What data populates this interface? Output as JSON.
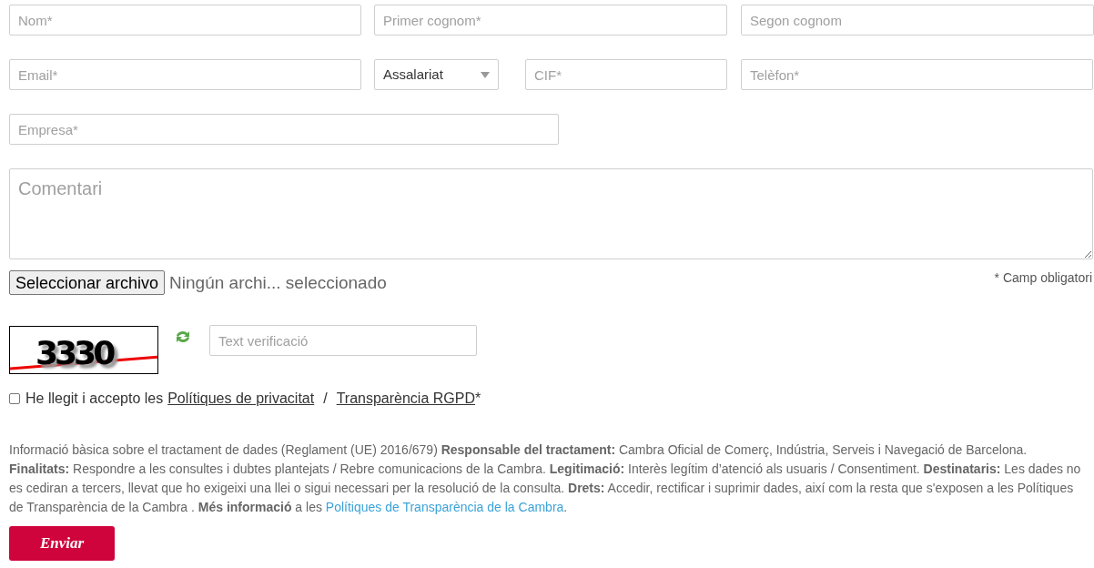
{
  "fields_row_1": [
    {
      "placeholder": "Nom*"
    },
    {
      "placeholder": "Primer cognom*"
    },
    {
      "placeholder": "Segon cognom"
    }
  ],
  "fields_row_2": [
    {
      "kind": "input",
      "placeholder": "Email*"
    },
    {
      "kind": "select",
      "value": "Assalariat"
    },
    {
      "kind": "input",
      "placeholder": "CIF*"
    },
    {
      "kind": "input",
      "placeholder": "Telèfon*"
    }
  ],
  "company": {
    "placeholder": "Empresa*"
  },
  "comment": {
    "placeholder": "Comentari"
  },
  "file_picker": {
    "button": "Seleccionar archivo",
    "status": "Ningún archi... seleccionado"
  },
  "required_note": "* Camp obligatori",
  "captcha": {
    "text": "3330",
    "input": {
      "placeholder": "Text verificació"
    }
  },
  "consent": {
    "checked": false,
    "text": "He llegit i accepto les",
    "links": [
      "Polítiques de privacitat",
      "Transparència RGPD"
    ],
    "separator": "/",
    "suffix": "*"
  },
  "legal_info": {
    "text": "Informació bàsica sobre el tractament de dades (Reglament (UE) 2016/679) **Responsable del tractament:** Cambra Oficial de Comerç, Indústria, Serveis i Navegació de Barcelona. **Finalitats:** Respondre a les consultes i dubtes plantejats / Rebre comunicacions de la Cambra. **Legitimació:** Interès legítim d’atenció als usuaris / Consentiment. **Destinataris:** Les dades no es cediran a tercers, llevat que ho exigeixi una llei o sigui necessari per la resolució de la consulta. **Drets:** Accedir, rectificar i suprimir dades, així com la resta que s'exposen a les Polítiques de Transparència de la Cambra . **Més informació** a les",
    "link": "Polítiques de Transparència de la Cambra",
    "after": "."
  },
  "submit_button": "Enviar"
}
